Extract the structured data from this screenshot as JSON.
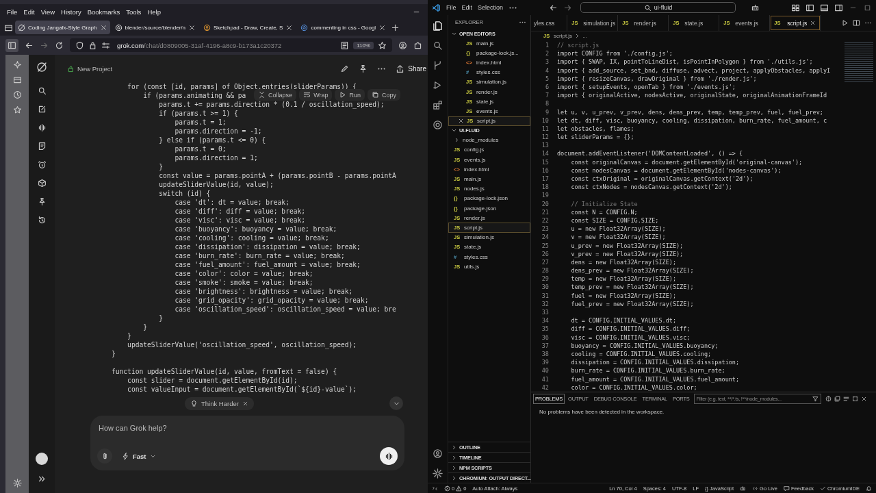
{
  "browser": {
    "menu": [
      "File",
      "Edit",
      "View",
      "History",
      "Bookmarks",
      "Tools",
      "Help"
    ],
    "tabs": [
      {
        "title": "Coding Jangafx-Style Graph",
        "selected": true
      },
      {
        "title": "blender/source/blender/n",
        "selected": false
      },
      {
        "title": "Sketchpad - Draw, Create, S",
        "selected": false
      },
      {
        "title": "commenting in css - Googl",
        "selected": false
      }
    ],
    "address": {
      "domain": "grok.com",
      "path": "/chat/d0809005-31af-4196-a8c9-b173a1c20372"
    },
    "zoom": "110%"
  },
  "grok": {
    "project": "New Project",
    "share": "Share",
    "code_toolbar": [
      "Collapse",
      "Wrap",
      "Run",
      "Copy"
    ],
    "code": [
      {
        "text": "    for (const [id, params] of Object.entries(sliderParams)) {"
      },
      {
        "text": "        if (params.animating && pa"
      },
      {
        "text": "            params.t += params.direction * (0.1 / oscillation_speed);"
      },
      {
        "text": "            if (params.t >= 1) {"
      },
      {
        "text": "                params.t = 1;"
      },
      {
        "text": "                params.direction = -1;"
      },
      {
        "text": "            } else if (params.t <= 0) {"
      },
      {
        "text": "                params.t = 0;"
      },
      {
        "text": "                params.direction = 1;"
      },
      {
        "text": "            }"
      },
      {
        "text": "            const value = params.pointA + (params.pointB - params.pointA"
      },
      {
        "text": "            updateSliderValue(id, value);"
      },
      {
        "text": "            switch (id) {"
      },
      {
        "text": "                case 'dt': dt = value; break;"
      },
      {
        "text": "                case 'diff': diff = value; break;"
      },
      {
        "text": "                case 'visc': visc = value; break;"
      },
      {
        "text": "                case 'buoyancy': buoyancy = value; break;"
      },
      {
        "text": "                case 'cooling': cooling = value; break;"
      },
      {
        "text": "                case 'dissipation': dissipation = value; break;"
      },
      {
        "text": "                case 'burn_rate': burn_rate = value; break;"
      },
      {
        "text": "                case 'fuel_amount': fuel_amount = value; break;"
      },
      {
        "text": "                case 'color': color = value; break;"
      },
      {
        "text": "                case 'smoke': smoke = value; break;"
      },
      {
        "text": "                case 'brightness': brightness = value; break;"
      },
      {
        "text": "                case 'grid_opacity': grid_opacity = value; break;"
      },
      {
        "text": "                case 'oscillation_speed': oscillation_speed = value; bre"
      },
      {
        "text": "            }"
      },
      {
        "text": "        }"
      },
      {
        "text": "    }"
      },
      {
        "text": "    updateSliderValue('oscillation_speed', oscillation_speed);"
      },
      {
        "text": "}"
      },
      {
        "text": "function updateSliderValue(id, value, fromText = false) {",
        "gap_before": true
      },
      {
        "text": "    const slider = document.getElementById(id);"
      },
      {
        "text": "    const valueInput = document.getElementById(`${id}-value`);"
      }
    ],
    "suggestion": "Think Harder",
    "input": {
      "placeholder": "How can Grok help?"
    },
    "mode": "Fast"
  },
  "vscode": {
    "menu": [
      "File",
      "Edit",
      "Selection"
    ],
    "search": "ui-fluid",
    "explorer_title": "EXPLORER",
    "sections": [
      {
        "title": "OPEN EDITORS",
        "expanded": true,
        "items": [
          {
            "name": "main.js",
            "icon": "JS",
            "kind": "js",
            "selected": false
          },
          {
            "name": "package-lock.js...",
            "icon": "{}",
            "kind": "json",
            "selected": false
          },
          {
            "name": "index.html",
            "icon": "<>",
            "kind": "html",
            "selected": false
          },
          {
            "name": "styles.css",
            "icon": "#",
            "kind": "css",
            "selected": false
          },
          {
            "name": "simulation.js",
            "icon": "JS",
            "kind": "js",
            "selected": false
          },
          {
            "name": "render.js",
            "icon": "JS",
            "kind": "js",
            "selected": false
          },
          {
            "name": "state.js",
            "icon": "JS",
            "kind": "js",
            "selected": false
          },
          {
            "name": "events.js",
            "icon": "JS",
            "kind": "js",
            "selected": false
          },
          {
            "name": "script.js",
            "icon": "JS",
            "kind": "js",
            "selected": true
          }
        ]
      },
      {
        "title": "UI-FLUID",
        "expanded": true,
        "items": [
          {
            "name": "node_modules",
            "kind": "folder",
            "expanded": false,
            "selected": false
          },
          {
            "name": "config.js",
            "icon": "JS",
            "kind": "js",
            "selected": false
          },
          {
            "name": "events.js",
            "icon": "JS",
            "kind": "js",
            "selected": false
          },
          {
            "name": "index.html",
            "icon": "<>",
            "kind": "html",
            "selected": false
          },
          {
            "name": "main.js",
            "icon": "JS",
            "kind": "js",
            "selected": false
          },
          {
            "name": "nodes.js",
            "icon": "JS",
            "kind": "js",
            "selected": false
          },
          {
            "name": "package-lock.json",
            "icon": "{}",
            "kind": "json",
            "selected": false
          },
          {
            "name": "package.json",
            "icon": "{}",
            "kind": "json",
            "selected": false
          },
          {
            "name": "render.js",
            "icon": "JS",
            "kind": "js",
            "selected": false
          },
          {
            "name": "script.js",
            "icon": "JS",
            "kind": "js",
            "selected": true
          },
          {
            "name": "simulation.js",
            "icon": "JS",
            "kind": "js",
            "selected": false
          },
          {
            "name": "state.js",
            "icon": "JS",
            "kind": "js",
            "selected": false
          },
          {
            "name": "styles.css",
            "icon": "#",
            "kind": "css",
            "selected": false
          },
          {
            "name": "utils.js",
            "icon": "JS",
            "kind": "js",
            "selected": false
          }
        ]
      }
    ],
    "collapsed_sections": [
      {
        "title": "OUTLINE",
        "expanded": false
      },
      {
        "title": "TIMELINE",
        "expanded": false
      },
      {
        "title": "NPM SCRIPTS",
        "expanded": false
      },
      {
        "title": "CHROMIUM: OUTPUT DIRECT...",
        "expanded": false
      }
    ],
    "tabs": [
      {
        "name": "yles.css",
        "selected": false
      },
      {
        "name": "simulation.js",
        "icon": "JS",
        "selected": false
      },
      {
        "name": "render.js",
        "icon": "JS",
        "selected": false
      },
      {
        "name": "state.js",
        "icon": "JS",
        "selected": false
      },
      {
        "name": "events.js",
        "icon": "JS",
        "selected": false
      },
      {
        "name": "script.js",
        "icon": "JS",
        "selected": true
      }
    ],
    "breadcrumb": {
      "icon": "JS",
      "file": "script.js",
      "rest": "..."
    },
    "lines": [
      {
        "no": "1",
        "text": "// script.js",
        "kind": "comment"
      },
      {
        "no": "2",
        "text": "import CONFIG from './config.js';",
        "kind": "code"
      },
      {
        "no": "3",
        "text": "import { SWAP, IX, pointToLineDist, isPointInPolygon } from './utils.js';",
        "kind": "code"
      },
      {
        "no": "4",
        "text": "import { add_source, set_bnd, diffuse, advect, project, applyObstacles, applyI",
        "kind": "code"
      },
      {
        "no": "5",
        "text": "import { resizeCanvas, drawOriginal } from './render.js';",
        "kind": "code"
      },
      {
        "no": "6",
        "text": "import { setupEvents, openTab } from './events.js';",
        "kind": "code"
      },
      {
        "no": "7",
        "text": "import { originalActive, nodesActive, originalState, originalAnimationFrameId",
        "kind": "code"
      },
      {
        "no": "8"
      },
      {
        "no": "9",
        "text": "let u, v, u_prev, v_prev, dens, dens_prev, temp, temp_prev, fuel, fuel_prev;",
        "kind": "code"
      },
      {
        "no": "10",
        "text": "let dt, diff, visc, buoyancy, cooling, dissipation, burn_rate, fuel_amount, c",
        "kind": "code"
      },
      {
        "no": "11",
        "text": "let obstacles, flames;",
        "kind": "code"
      },
      {
        "no": "12",
        "text": "let sliderParams = {};",
        "kind": "code"
      },
      {
        "no": "13"
      },
      {
        "no": "14",
        "text": "document.addEventListener('DOMContentLoaded', () => {",
        "kind": "code"
      },
      {
        "no": "15",
        "text": "    const originalCanvas = document.getElementById('original-canvas');",
        "kind": "code"
      },
      {
        "no": "16",
        "text": "    const nodesCanvas = document.getElementById('nodes-canvas');",
        "kind": "code"
      },
      {
        "no": "17",
        "text": "    const ctxOriginal = originalCanvas.getContext('2d');",
        "kind": "code"
      },
      {
        "no": "18",
        "text": "    const ctxNodes = nodesCanvas.getContext('2d');",
        "kind": "code"
      },
      {
        "no": "19"
      },
      {
        "no": "20",
        "text": "    // Initialize State",
        "kind": "comment"
      },
      {
        "no": "21",
        "text": "    const N = CONFIG.N;",
        "kind": "code"
      },
      {
        "no": "22",
        "text": "    const SIZE = CONFIG.SIZE;",
        "kind": "code"
      },
      {
        "no": "23",
        "text": "    u = new Float32Array(SIZE);",
        "kind": "code"
      },
      {
        "no": "24",
        "text": "    v = new Float32Array(SIZE);",
        "kind": "code"
      },
      {
        "no": "25",
        "text": "    u_prev = new Float32Array(SIZE);",
        "kind": "code"
      },
      {
        "no": "26",
        "text": "    v_prev = new Float32Array(SIZE);",
        "kind": "code"
      },
      {
        "no": "27",
        "text": "    dens = new Float32Array(SIZE);",
        "kind": "code"
      },
      {
        "no": "28",
        "text": "    dens_prev = new Float32Array(SIZE);",
        "kind": "code"
      },
      {
        "no": "29",
        "text": "    temp = new Float32Array(SIZE);",
        "kind": "code"
      },
      {
        "no": "30",
        "text": "    temp_prev = new Float32Array(SIZE);",
        "kind": "code"
      },
      {
        "no": "31",
        "text": "    fuel = new Float32Array(SIZE);",
        "kind": "code"
      },
      {
        "no": "32",
        "text": "    fuel_prev = new Float32Array(SIZE);",
        "kind": "code"
      },
      {
        "no": "33"
      },
      {
        "no": "34",
        "text": "    dt = CONFIG.INITIAL_VALUES.dt;",
        "kind": "code"
      },
      {
        "no": "35",
        "text": "    diff = CONFIG.INITIAL_VALUES.diff;",
        "kind": "code"
      },
      {
        "no": "36",
        "text": "    visc = CONFIG.INITIAL_VALUES.visc;",
        "kind": "code"
      },
      {
        "no": "37",
        "text": "    buoyancy = CONFIG.INITIAL_VALUES.buoyancy;",
        "kind": "code"
      },
      {
        "no": "38",
        "text": "    cooling = CONFIG.INITIAL_VALUES.cooling;",
        "kind": "code"
      },
      {
        "no": "39",
        "text": "    dissipation = CONFIG.INITIAL_VALUES.dissipation;",
        "kind": "code"
      },
      {
        "no": "40",
        "text": "    burn_rate = CONFIG.INITIAL_VALUES.burn_rate;",
        "kind": "code"
      },
      {
        "no": "41",
        "text": "    fuel_amount = CONFIG.INITIAL_VALUES.fuel_amount;",
        "kind": "code"
      },
      {
        "no": "42",
        "text": "    color = CONFIG.INITIAL_VALUES.color;",
        "kind": "code"
      }
    ],
    "panel": {
      "tabs": [
        {
          "label": "PROBLEMS",
          "selected": true
        },
        {
          "label": "OUTPUT",
          "selected": false
        },
        {
          "label": "DEBUG CONSOLE",
          "selected": false
        },
        {
          "label": "TERMINAL",
          "selected": false
        },
        {
          "label": "PORTS",
          "selected": false
        }
      ],
      "filter": {
        "placeholder": "Filter (e.g. text, **/*.ts, !**/node_modules..."
      },
      "message": "No problems have been detected in the workspace."
    },
    "status": {
      "errors": "0",
      "warnings": "0",
      "auto_attach": "Auto Attach: Always",
      "position": "Ln 70, Col 4",
      "spaces": "Spaces: 4",
      "encoding": "UTF-8",
      "eol": "LF",
      "language_icon": "{}",
      "language": "JavaScript",
      "go_live": "Go Live",
      "feedback": "Feedback",
      "extension": "ChromiumIDE"
    }
  }
}
